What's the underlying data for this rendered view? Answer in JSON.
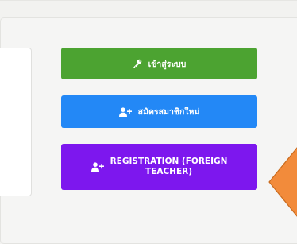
{
  "buttons": {
    "login_label": "เข้าสู่ระบบ",
    "register_label": "สมัครสมาชิกใหม่",
    "foreign_line1": "REGISTRATION (FOREIGN",
    "foreign_line2": "TEACHER)"
  },
  "icons": {
    "login": "key-icon",
    "register": "user-plus-icon",
    "foreign": "user-plus-icon"
  },
  "colors": {
    "login": "#4ca331",
    "register": "#2388f6",
    "foreign": "#7d17ee",
    "arrow_fill": "#f28b3b",
    "arrow_stroke": "#c96b1e"
  }
}
